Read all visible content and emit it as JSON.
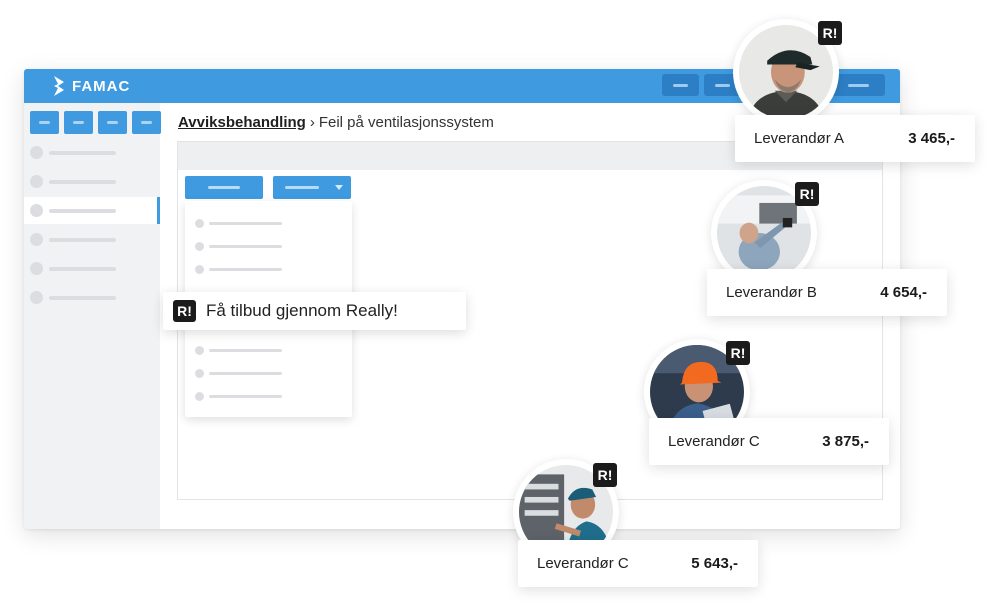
{
  "app": {
    "name": "FAMAC",
    "brand_color": "#3f9ae0"
  },
  "breadcrumb": {
    "root": "Avviksbehandling",
    "separator": "›",
    "current": "Feil på ventilasjonssystem"
  },
  "callout": {
    "badge": "R!",
    "text": "Få tilbud gjennom Really!"
  },
  "suppliers": [
    {
      "badge": "R!",
      "name": "Leverandør A",
      "price": "3 465,-",
      "photo": "worker-cap-portrait"
    },
    {
      "badge": "R!",
      "name": "Leverandør B",
      "price": "4 654,-",
      "photo": "technician-ceiling-vent"
    },
    {
      "badge": "R!",
      "name": "Leverandør C",
      "price": "3 875,-",
      "photo": "technician-hardhat-tablet"
    },
    {
      "badge": "R!",
      "name": "Leverandør C",
      "price": "5 643,-",
      "photo": "technician-electrical-panel"
    }
  ]
}
